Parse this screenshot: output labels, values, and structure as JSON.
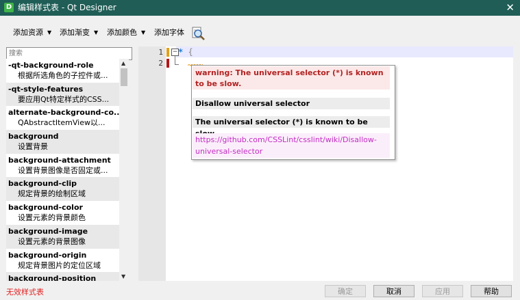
{
  "window": {
    "title": "编辑样式表 - Qt Designer",
    "app_icon": "D"
  },
  "toolbar": {
    "add_resource": "添加资源",
    "add_gradient": "添加渐变",
    "add_color": "添加颜色",
    "add_font": "添加字体",
    "dropdown_arrow": "▼"
  },
  "search": {
    "placeholder": "搜索"
  },
  "properties": [
    {
      "name": "-qt-background-role",
      "desc": "根据所选角色的子控件或..."
    },
    {
      "name": "-qt-style-features",
      "desc": "要应用Qt特定样式的CSS..."
    },
    {
      "name": "alternate-background-co...",
      "desc": "QAbstractItemView以..."
    },
    {
      "name": "background",
      "desc": "设置背景"
    },
    {
      "name": "background-attachment",
      "desc": "设置背景图像是否固定或..."
    },
    {
      "name": "background-clip",
      "desc": "规定背景的绘制区域"
    },
    {
      "name": "background-color",
      "desc": "设置元素的背景颜色"
    },
    {
      "name": "background-image",
      "desc": "设置元素的背景图像"
    },
    {
      "name": "background-origin",
      "desc": "规定背景图片的定位区域"
    },
    {
      "name": "background-position",
      "desc": ""
    }
  ],
  "editor": {
    "line_numbers": [
      "1",
      "2"
    ],
    "line1_selector": "*",
    "line1_brace": "{"
  },
  "tooltip": {
    "warning": "warning: The universal selector (*) is known to be slow.",
    "rule": "Disallow universal selector",
    "description": "The universal selector (*) is known to be slow.",
    "link": "https://github.com/CSSLint/csslint/wiki/Disallow-universal-selector"
  },
  "status": {
    "text": "无效样式表"
  },
  "buttons": {
    "ok": "确定",
    "cancel": "取消",
    "apply": "应用",
    "help": "帮助"
  },
  "colors": {
    "titlebar": "#1f5d56",
    "warning_text": "#b22222",
    "link_text": "#c22bc2",
    "status_text": "#e02020"
  }
}
